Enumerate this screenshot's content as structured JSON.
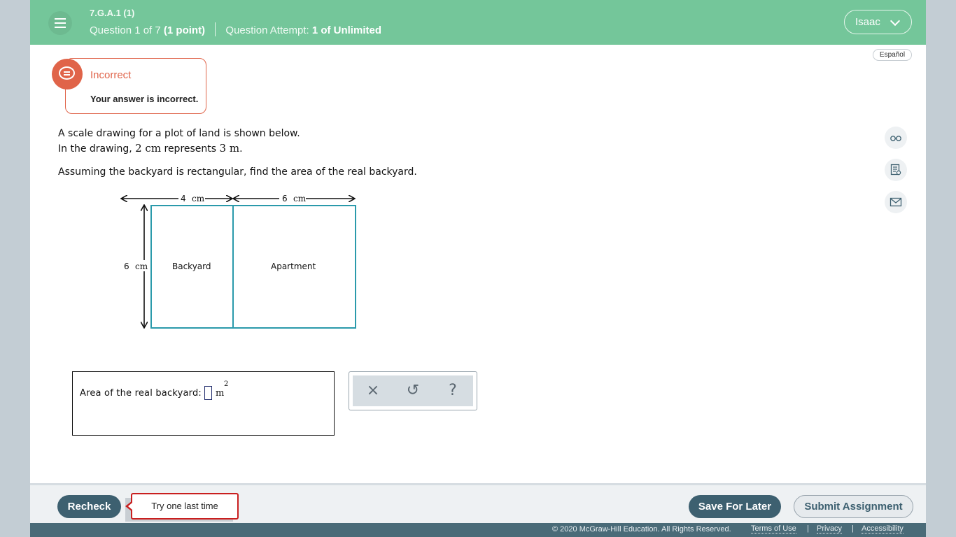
{
  "header": {
    "standard_code": "7.G.A.1 (1)",
    "question_prefix": "Question 1 of 7",
    "question_points": "(1 point)",
    "attempt_prefix": "Question Attempt:",
    "attempt_value": "1 of Unlimited",
    "user_name": "Isaac"
  },
  "language_toggle": "Español",
  "feedback": {
    "title": "Incorrect",
    "message": "Your answer is incorrect."
  },
  "question": {
    "line1": "A scale drawing for a plot of land is shown below.",
    "line2_prefix": "In the drawing,",
    "line2_scale1": "2 cm",
    "line2_mid": "represents",
    "line2_scale2": "3 m",
    "line2_end": ".",
    "line3": "Assuming the backyard is rectangular, find the area of the real backyard."
  },
  "diagram": {
    "top_left_num": "4",
    "top_left_unit": "cm",
    "top_right_num": "6",
    "top_right_unit": "cm",
    "left_num": "6",
    "left_unit": "cm",
    "region_left": "Backyard",
    "region_right": "Apartment",
    "stroke_color": "#2a9aab"
  },
  "answer": {
    "label": "Area of the real backyard:",
    "value": "",
    "unit": "m",
    "exponent": "2"
  },
  "tools": {
    "clear_icon": "×",
    "undo_icon": "↺",
    "help_icon": "?"
  },
  "footer": {
    "recheck_label": "Recheck",
    "tip_text": "Try one last time",
    "save_label": "Save For Later",
    "submit_label": "Submit Assignment",
    "copyright": "© 2020 McGraw-Hill Education. All Rights Reserved.",
    "terms": "Terms of Use",
    "privacy": "Privacy",
    "accessibility": "Accessibility",
    "separator": "|"
  },
  "colors": {
    "header_bg": "#74c69a",
    "incorrect": "#e0654b",
    "primary_button": "#3d6070",
    "tip_border": "#c91f1f"
  }
}
